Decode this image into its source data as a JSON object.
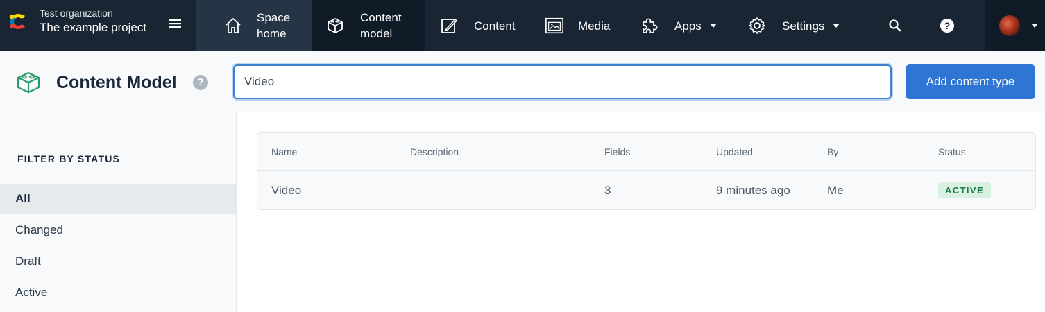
{
  "org": {
    "organization": "Test organization",
    "project": "The example project",
    "logo_icon": "contentful-logo-icon",
    "menu_icon": "hamburger-menu-icon"
  },
  "nav": {
    "space_home": {
      "line1": "Space",
      "line2": "home",
      "icon": "home-icon"
    },
    "content_model": {
      "line1": "Content",
      "line2": "model",
      "icon": "cube-icon"
    },
    "content": {
      "label": "Content",
      "icon": "edit-icon"
    },
    "media": {
      "label": "Media",
      "icon": "image-icon"
    },
    "apps": {
      "label": "Apps",
      "icon": "puzzle-icon"
    },
    "settings": {
      "label": "Settings",
      "icon": "gear-icon"
    },
    "search_icon": "search-icon",
    "help_icon": "help-icon",
    "account_icon": "avatar"
  },
  "header": {
    "title": "Content Model",
    "help": "?",
    "search_value": "Video",
    "add_button": "Add content type"
  },
  "sidebar": {
    "title": "FILTER BY STATUS",
    "filters": [
      {
        "label": "All",
        "selected": true
      },
      {
        "label": "Changed",
        "selected": false
      },
      {
        "label": "Draft",
        "selected": false
      },
      {
        "label": "Active",
        "selected": false
      }
    ]
  },
  "table": {
    "columns": [
      "Name",
      "Description",
      "Fields",
      "Updated",
      "By",
      "Status"
    ],
    "rows": [
      {
        "name": "Video",
        "description": "",
        "fields": "3",
        "updated": "9 minutes ago",
        "by": "Me",
        "status": "ACTIVE"
      }
    ]
  },
  "colors": {
    "topbar": "#192532",
    "accent": "#2e75d4",
    "active_badge_bg": "#d8f1e2",
    "active_badge_text": "#1a7a4b"
  }
}
